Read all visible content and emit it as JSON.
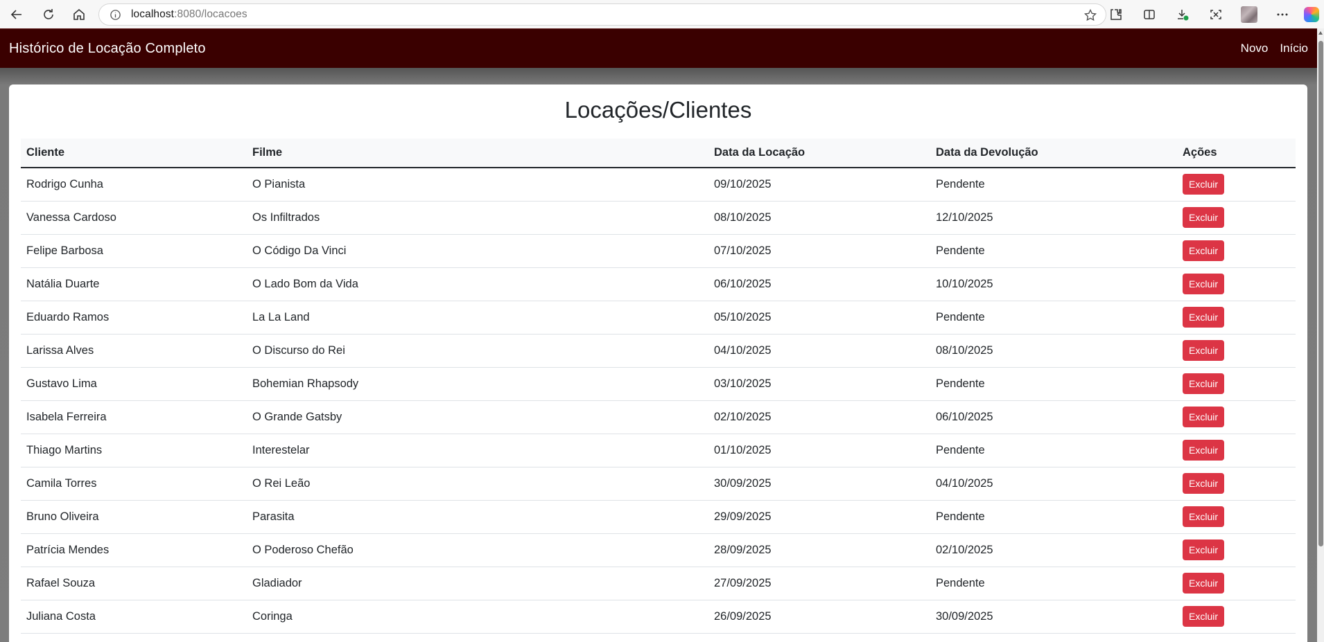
{
  "browser": {
    "url_host": "localhost",
    "url_path": ":8080/locacoes",
    "icons": [
      "back-icon",
      "reload-icon",
      "home-icon",
      "info-icon",
      "star-icon",
      "extensions-icon",
      "split-screen-icon",
      "downloads-icon",
      "screenshot-icon",
      "avatar",
      "more-icon",
      "copilot-icon"
    ]
  },
  "navbar": {
    "brand": "Histórico de Locação Completo",
    "links": [
      "Novo",
      "Início"
    ],
    "background": "#3a0000"
  },
  "page": {
    "title": "Locações/Clientes"
  },
  "table": {
    "headers": [
      "Cliente",
      "Filme",
      "Data da Locação",
      "Data da Devolução",
      "Ações"
    ],
    "action_label": "Excluir",
    "action_color": "#dc3545",
    "rows": [
      [
        "Rodrigo Cunha",
        "O Pianista",
        "09/10/2025",
        "Pendente"
      ],
      [
        "Vanessa Cardoso",
        "Os Infiltrados",
        "08/10/2025",
        "12/10/2025"
      ],
      [
        "Felipe Barbosa",
        "O Código Da Vinci",
        "07/10/2025",
        "Pendente"
      ],
      [
        "Natália Duarte",
        "O Lado Bom da Vida",
        "06/10/2025",
        "10/10/2025"
      ],
      [
        "Eduardo Ramos",
        "La La Land",
        "05/10/2025",
        "Pendente"
      ],
      [
        "Larissa Alves",
        "O Discurso do Rei",
        "04/10/2025",
        "08/10/2025"
      ],
      [
        "Gustavo Lima",
        "Bohemian Rhapsody",
        "03/10/2025",
        "Pendente"
      ],
      [
        "Isabela Ferreira",
        "O Grande Gatsby",
        "02/10/2025",
        "06/10/2025"
      ],
      [
        "Thiago Martins",
        "Interestelar",
        "01/10/2025",
        "Pendente"
      ],
      [
        "Camila Torres",
        "O Rei Leão",
        "30/09/2025",
        "04/10/2025"
      ],
      [
        "Bruno Oliveira",
        "Parasita",
        "29/09/2025",
        "Pendente"
      ],
      [
        "Patrícia Mendes",
        "O Poderoso Chefão",
        "28/09/2025",
        "02/10/2025"
      ],
      [
        "Rafael Souza",
        "Gladiador",
        "27/09/2025",
        "Pendente"
      ],
      [
        "Juliana Costa",
        "Coringa",
        "26/09/2025",
        "30/09/2025"
      ]
    ]
  }
}
